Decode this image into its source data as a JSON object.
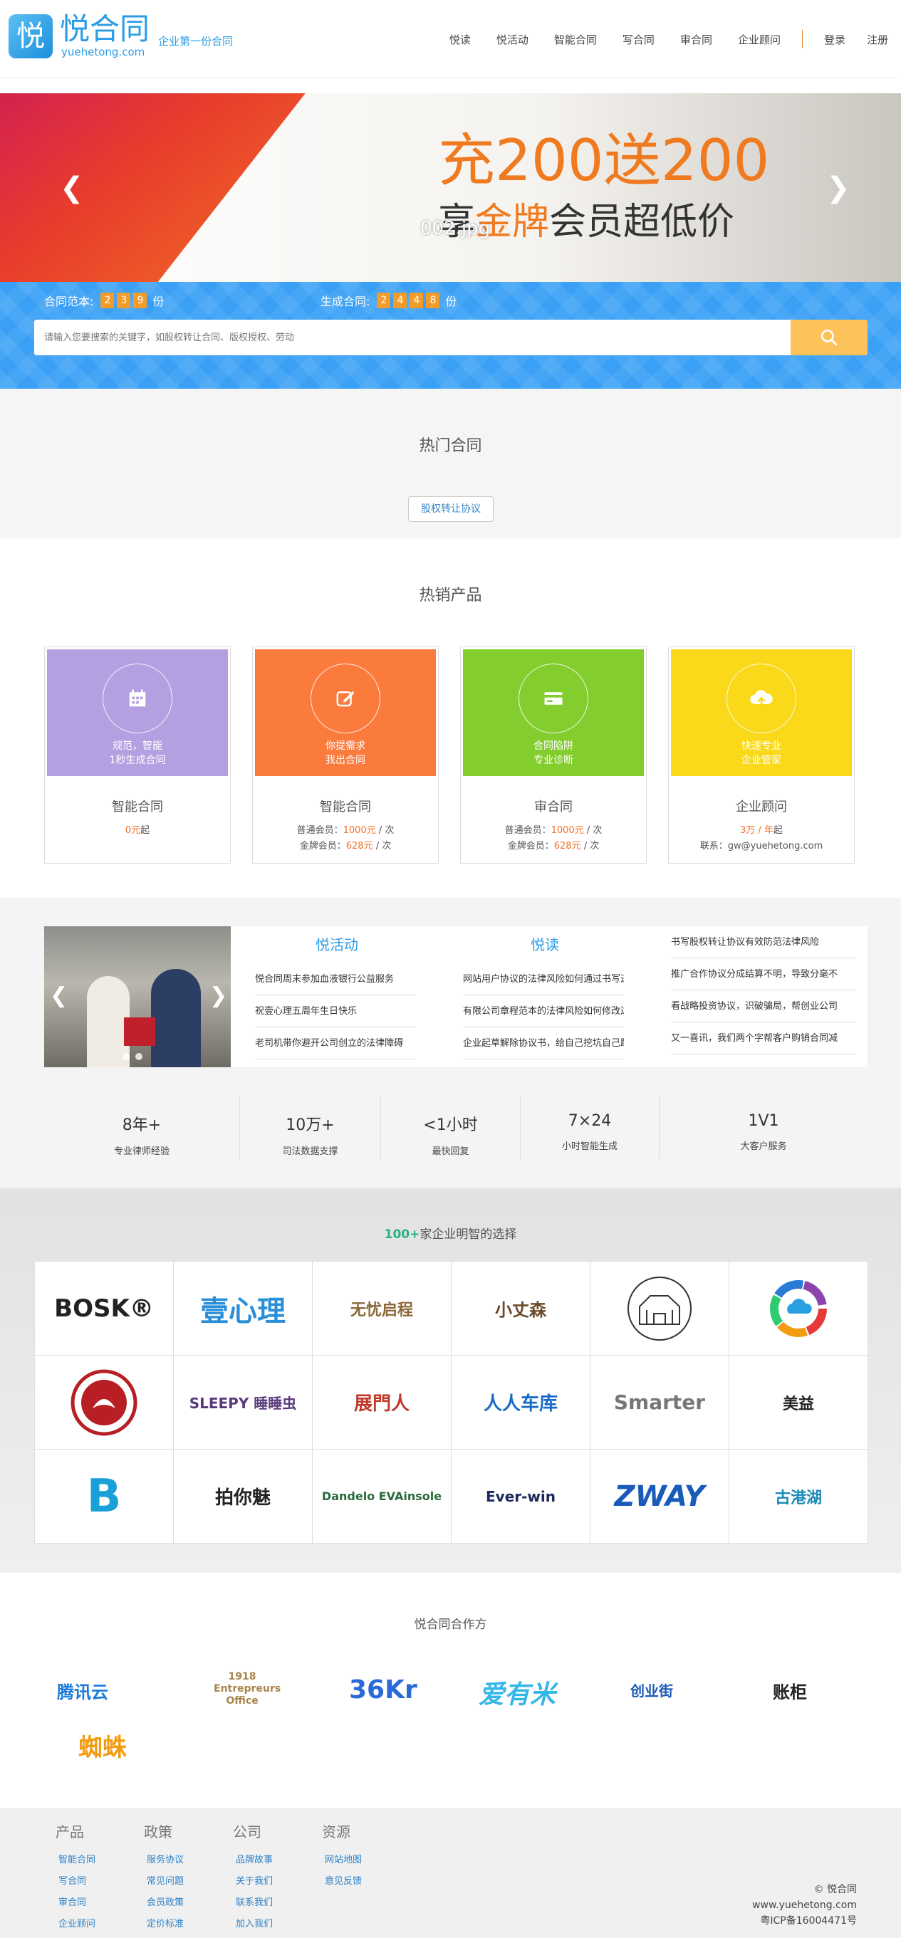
{
  "header": {
    "logo_glyph": "悦",
    "logo_name": "悦合同",
    "logo_domain": "yuehetong.com",
    "slogan": "企业第一份合同",
    "nav": [
      "悦读",
      "悦活动",
      "智能合同",
      "写合同",
      "审合同",
      "企业顾问"
    ],
    "login": "登录",
    "register": "注册"
  },
  "banner": {
    "line1_pre": "充",
    "line1_num1": "200",
    "line1_mid": "送",
    "line1_num2": "200",
    "line2_pre": "享",
    "line2_hi": "金牌",
    "line2_post": "会员超低价",
    "filename": "002.jpg",
    "prev_icon": "chevron-left-icon",
    "next_icon": "chevron-right-icon"
  },
  "stats": {
    "templates_label": "合同范本:",
    "templates_digits": [
      "2",
      "3",
      "9"
    ],
    "templates_unit": "份",
    "generated_label": "生成合同:",
    "generated_digits": [
      "2",
      "4",
      "4",
      "8"
    ],
    "generated_unit": "份"
  },
  "search": {
    "placeholder": "请输入您要搜索的关键字，如股权转让合同、版权授权、劳动",
    "icon": "search-icon"
  },
  "hot": {
    "title": "热门合同",
    "tag": "股权转让协议"
  },
  "products": {
    "title": "热销产品",
    "cards": [
      {
        "color": "#b4a0e0",
        "icon": "calendar-icon",
        "desc1": "规范，智能",
        "desc2": "1秒生成合同",
        "name": "智能合同",
        "price": "0元",
        "price_suffix": "起",
        "l2": ""
      },
      {
        "color": "#fb7b3c",
        "icon": "edit-icon",
        "desc1": "你提需求",
        "desc2": "我出合同",
        "name": "智能合同",
        "l1_pre": "普通会员：",
        "l1_price": "1000元",
        "l1_post": " / 次",
        "l2_pre": "金牌会员：",
        "l2_price": "628元",
        "l2_post": " / 次"
      },
      {
        "color": "#84cd2e",
        "icon": "card-icon",
        "desc1": "合同陷阱",
        "desc2": "专业诊断",
        "name": "审合同",
        "l1_pre": "普通会员：",
        "l1_price": "1000元",
        "l1_post": " / 次",
        "l2_pre": "金牌会员：",
        "l2_price": "628元",
        "l2_post": " / 次"
      },
      {
        "color": "#f9d91a",
        "icon": "cloud-upload-icon",
        "desc1": "快速专业",
        "desc2": "企业管家",
        "name": "企业顾问",
        "price": "3万 / 年",
        "price_suffix": "起",
        "contact": "联系：gw@yuehetong.com"
      }
    ]
  },
  "news": {
    "activity_title": "悦活动",
    "activity_items": [
      "悦合同周末参加血液银行公益服务",
      "祝壹心理五周年生日快乐",
      "老司机带你避开公司创立的法律障碍"
    ],
    "read_title": "悦读",
    "read_items": [
      "网站用户协议的法律风险如何通过书写进",
      "有限公司章程范本的法律风险如何修改达",
      "企业起草解除协议书，给自己挖坑自己跳"
    ],
    "more_items": [
      "书写股权转让协议有效防范法律风险",
      "推广合作协议分成结算不明，导致分毫不",
      "看战略投资协议，识破骗局，帮创业公司",
      "又一喜讯，我们两个字帮客户购销合同减"
    ]
  },
  "kpis": [
    {
      "value": "8年+",
      "desc": "专业律师经验"
    },
    {
      "value": "10万+",
      "desc": "司法数据支撑"
    },
    {
      "value": "<1小时",
      "desc": "最快回复"
    },
    {
      "value": "7×24",
      "desc": "小时智能生成"
    },
    {
      "value": "1V1",
      "desc": "大客户服务"
    }
  ],
  "brands": {
    "title_hi": "100+",
    "title_rest": "家企业明智的选择",
    "logos": [
      {
        "text": "BOSK®",
        "color": "#222"
      },
      {
        "text": "壹心理",
        "color": "#2a8fd8"
      },
      {
        "text": "无忧启程",
        "color": "#8a6a3a"
      },
      {
        "text": "小丈森",
        "color": "#6b4a2a"
      },
      {
        "text": "",
        "color": "#333"
      },
      {
        "text": "",
        "color": "#c33"
      },
      {
        "text": "",
        "color": "#b81f24"
      },
      {
        "text": "SLEEPY 睡睡虫",
        "color": "#5a3a7a"
      },
      {
        "text": "展門人",
        "color": "#c0392b"
      },
      {
        "text": "人人车库",
        "color": "#1a6bc8"
      },
      {
        "text": "Smarter",
        "color": "#777"
      },
      {
        "text": "美益",
        "color": "#222"
      },
      {
        "text": "B",
        "color": "#1aa0d8"
      },
      {
        "text": "拍你魅",
        "color": "#222"
      },
      {
        "text": "Dandelo EVAinsole",
        "color": "#2a6a3a"
      },
      {
        "text": "Ever-win",
        "color": "#1a2a5a"
      },
      {
        "text": "ZWAY",
        "color": "#1a5ab8"
      },
      {
        "text": "古港湖",
        "color": "#1a8ab8"
      }
    ]
  },
  "partners": {
    "title": "悦合同合作方",
    "logos": [
      "腾讯云",
      "1918 Entrepreurs Office",
      "36Kr",
      "爱有米",
      "创业街",
      "账柜",
      "蜘蛛"
    ]
  },
  "footer": {
    "cols": [
      {
        "title": "产品",
        "links": [
          "智能合同",
          "写合同",
          "审合同",
          "企业顾问"
        ]
      },
      {
        "title": "政策",
        "links": [
          "服务协议",
          "常见问题",
          "会员政策",
          "定价标准"
        ]
      },
      {
        "title": "公司",
        "links": [
          "品牌故事",
          "关于我们",
          "联系我们",
          "加入我们"
        ]
      },
      {
        "title": "资源",
        "links": [
          "网站地图",
          "意见反馈"
        ]
      }
    ],
    "copyright": "© 悦合同",
    "site": "www.yuehetong.com",
    "icp": "粤ICP备16004471号"
  }
}
